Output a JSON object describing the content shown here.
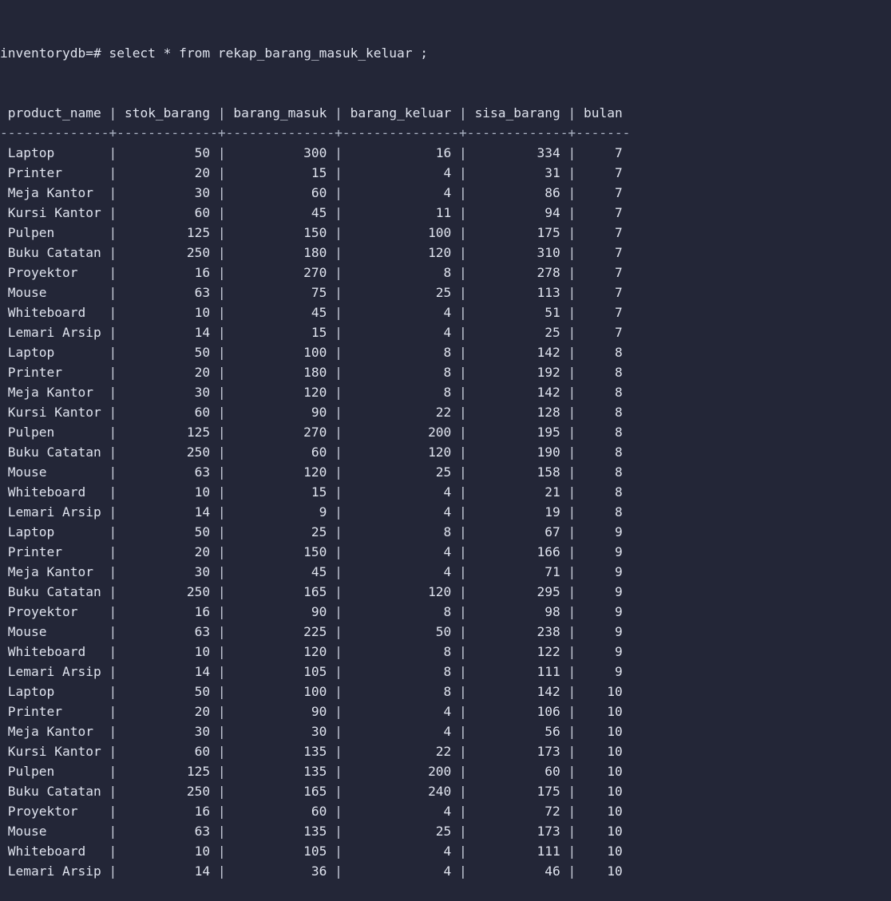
{
  "prompt": "inventorydb=#",
  "command": "select * from rekap_barang_masuk_keluar ;",
  "columns": [
    "product_name",
    "stok_barang",
    "barang_masuk",
    "barang_keluar",
    "sisa_barang",
    "bulan"
  ],
  "rows": [
    [
      "Laptop",
      50,
      300,
      16,
      334,
      7
    ],
    [
      "Printer",
      20,
      15,
      4,
      31,
      7
    ],
    [
      "Meja Kantor",
      30,
      60,
      4,
      86,
      7
    ],
    [
      "Kursi Kantor",
      60,
      45,
      11,
      94,
      7
    ],
    [
      "Pulpen",
      125,
      150,
      100,
      175,
      7
    ],
    [
      "Buku Catatan",
      250,
      180,
      120,
      310,
      7
    ],
    [
      "Proyektor",
      16,
      270,
      8,
      278,
      7
    ],
    [
      "Mouse",
      63,
      75,
      25,
      113,
      7
    ],
    [
      "Whiteboard",
      10,
      45,
      4,
      51,
      7
    ],
    [
      "Lemari Arsip",
      14,
      15,
      4,
      25,
      7
    ],
    [
      "Laptop",
      50,
      100,
      8,
      142,
      8
    ],
    [
      "Printer",
      20,
      180,
      8,
      192,
      8
    ],
    [
      "Meja Kantor",
      30,
      120,
      8,
      142,
      8
    ],
    [
      "Kursi Kantor",
      60,
      90,
      22,
      128,
      8
    ],
    [
      "Pulpen",
      125,
      270,
      200,
      195,
      8
    ],
    [
      "Buku Catatan",
      250,
      60,
      120,
      190,
      8
    ],
    [
      "Mouse",
      63,
      120,
      25,
      158,
      8
    ],
    [
      "Whiteboard",
      10,
      15,
      4,
      21,
      8
    ],
    [
      "Lemari Arsip",
      14,
      9,
      4,
      19,
      8
    ],
    [
      "Laptop",
      50,
      25,
      8,
      67,
      9
    ],
    [
      "Printer",
      20,
      150,
      4,
      166,
      9
    ],
    [
      "Meja Kantor",
      30,
      45,
      4,
      71,
      9
    ],
    [
      "Buku Catatan",
      250,
      165,
      120,
      295,
      9
    ],
    [
      "Proyektor",
      16,
      90,
      8,
      98,
      9
    ],
    [
      "Mouse",
      63,
      225,
      50,
      238,
      9
    ],
    [
      "Whiteboard",
      10,
      120,
      8,
      122,
      9
    ],
    [
      "Lemari Arsip",
      14,
      105,
      8,
      111,
      9
    ],
    [
      "Laptop",
      50,
      100,
      8,
      142,
      10
    ],
    [
      "Printer",
      20,
      90,
      4,
      106,
      10
    ],
    [
      "Meja Kantor",
      30,
      30,
      4,
      56,
      10
    ],
    [
      "Kursi Kantor",
      60,
      135,
      22,
      173,
      10
    ],
    [
      "Pulpen",
      125,
      135,
      200,
      60,
      10
    ],
    [
      "Buku Catatan",
      250,
      165,
      240,
      175,
      10
    ],
    [
      "Proyektor",
      16,
      60,
      4,
      72,
      10
    ],
    [
      "Mouse",
      63,
      135,
      25,
      173,
      10
    ],
    [
      "Whiteboard",
      10,
      105,
      4,
      111,
      10
    ],
    [
      "Lemari Arsip",
      14,
      36,
      4,
      46,
      10
    ]
  ],
  "colors": {
    "background": "#232637",
    "text": "#dfe3ee"
  }
}
